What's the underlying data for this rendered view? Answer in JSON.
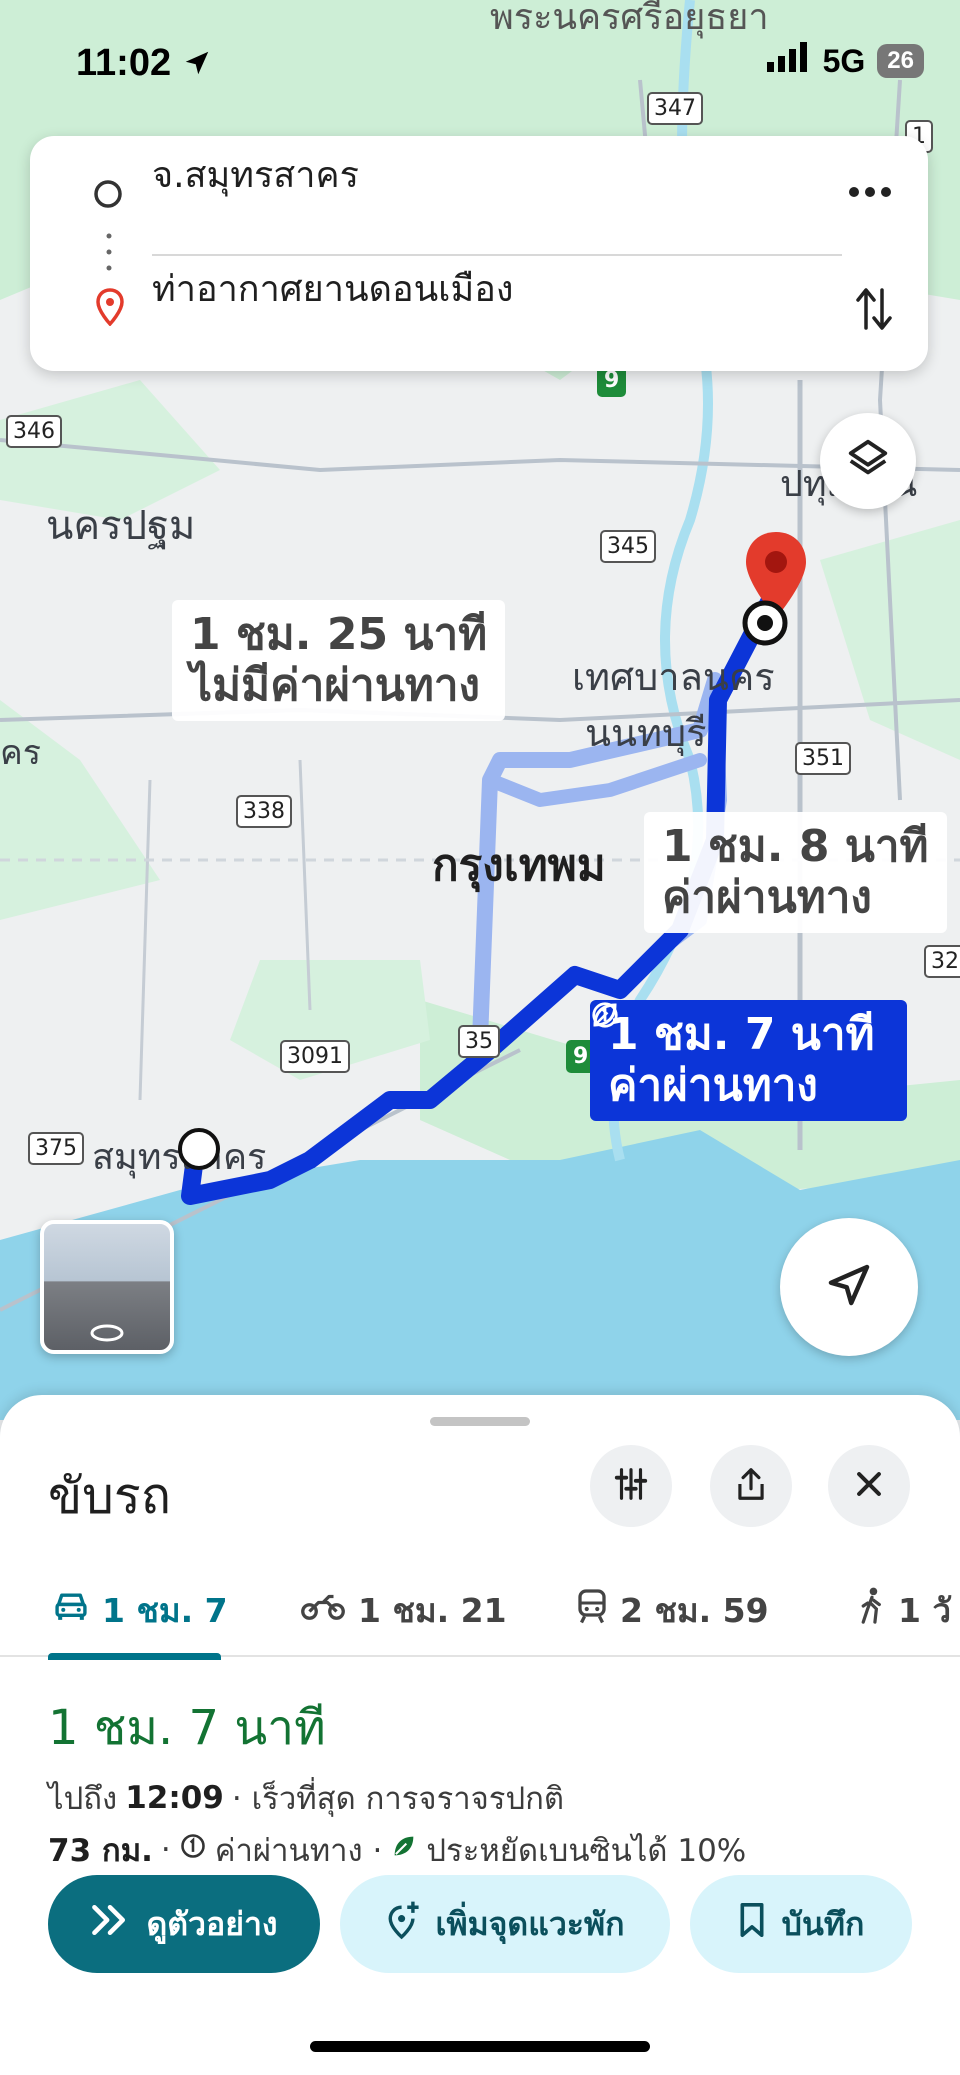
{
  "status_bar": {
    "time": "11:02",
    "network": "5G",
    "battery": "26"
  },
  "search": {
    "origin": "จ.สมุทรสาคร",
    "destination": "ท่าอากาศยานดอนเมือง"
  },
  "map": {
    "place_labels": {
      "ayutthaya": "พระนครศรีอยุธยา",
      "nakhon_pathom": "นครปฐม",
      "pathum": "ปทุมธานี",
      "nonthaburi_city": "เทศบาลนคร",
      "nonthaburi": "นนทบุรี",
      "nonburi_partial": "นนทบุรี",
      "bangkok": "กรุงเทพม",
      "samut_sakhon": "สมุทรสาคร",
      "left_edge": "คร"
    },
    "road_shields": [
      "347",
      "1",
      "346",
      "345",
      "351",
      "338",
      "3091",
      "35",
      "375",
      "32",
      "9",
      "9"
    ],
    "route_options": {
      "alt1": {
        "time": "1 ชม. 25 นาที",
        "toll": "ไม่มีค่าผ่านทาง"
      },
      "alt2": {
        "time": "1 ชม. 8 นาที",
        "toll": "ค่าผ่านทาง"
      },
      "main": {
        "time": "1 ชม. 7 นาที",
        "toll": "ค่าผ่านทาง"
      }
    }
  },
  "sheet": {
    "title": "ขับรถ",
    "modes": [
      {
        "label": "1 ชม. 7",
        "icon": "car-icon"
      },
      {
        "label": "1 ชม. 21",
        "icon": "motorcycle-icon"
      },
      {
        "label": "2 ชม. 59",
        "icon": "train-icon"
      },
      {
        "label": "1 วั",
        "icon": "walk-icon"
      }
    ],
    "duration": "1 ชม. 7 นาที",
    "arrive_prefix": "ไปถึง",
    "arrive_time": "12:09",
    "arrive_suffix": "· เร็วที่สุด การจราจรปกติ",
    "distance": "73 กม.",
    "toll_text": "ค่าผ่านทาง ·",
    "fuel_text": "ประหยัดเบนซินได้ 10%",
    "buttons": {
      "preview": "ดูตัวอย่าง",
      "add_stop": "เพิ่มจุดแวะพัก",
      "save": "บันทึก"
    }
  },
  "colors": {
    "route_main": "#0c35d8",
    "route_alt": "#9bb5f0",
    "accent": "#0b6e7f",
    "duration_green": "#137333",
    "water": "#8fd3ea",
    "park": "#c8ecd5"
  }
}
